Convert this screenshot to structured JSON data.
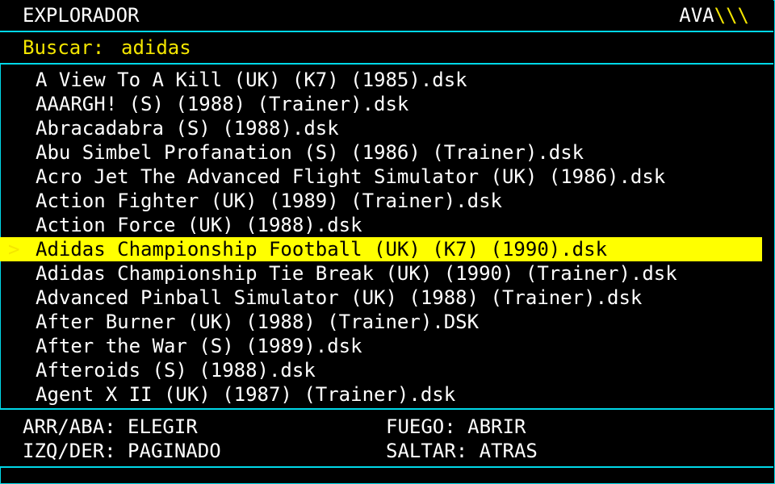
{
  "header": {
    "title": "EXPLORADOR",
    "brand_text": "AVA",
    "brand_slashes": "\\\\\\",
    "accent_color": "#00d8e8",
    "highlight_color": "#ffff00"
  },
  "search": {
    "label": "Buscar:",
    "query": "adidas"
  },
  "list": {
    "selector_glyph": ">",
    "selected_index": 7,
    "items": [
      "A View To A Kill (UK) (K7) (1985).dsk",
      "AAARGH! (S) (1988) (Trainer).dsk",
      "Abracadabra (S) (1988).dsk",
      "Abu Simbel Profanation (S) (1986) (Trainer).dsk",
      "Acro Jet The Advanced Flight Simulator (UK) (1986).dsk",
      "Action Fighter (UK) (1989) (Trainer).dsk",
      "Action Force (UK) (1988).dsk",
      "Adidas Championship Football (UK) (K7) (1990).dsk",
      "Adidas Championship Tie Break (UK) (1990) (Trainer).dsk",
      "Advanced Pinball Simulator (UK) (1988) (Trainer).dsk",
      "After Burner (UK) (1988) (Trainer).DSK",
      "After the War (S) (1989).dsk",
      "Afteroids (S) (1988).dsk",
      "Agent X II (UK) (1987) (Trainer).dsk"
    ]
  },
  "footer": {
    "help": [
      "ARR/ABA: ELEGIR",
      "IZQ/DER: PAGINADO",
      "FUEGO: ABRIR",
      "SALTAR: ATRAS"
    ]
  }
}
